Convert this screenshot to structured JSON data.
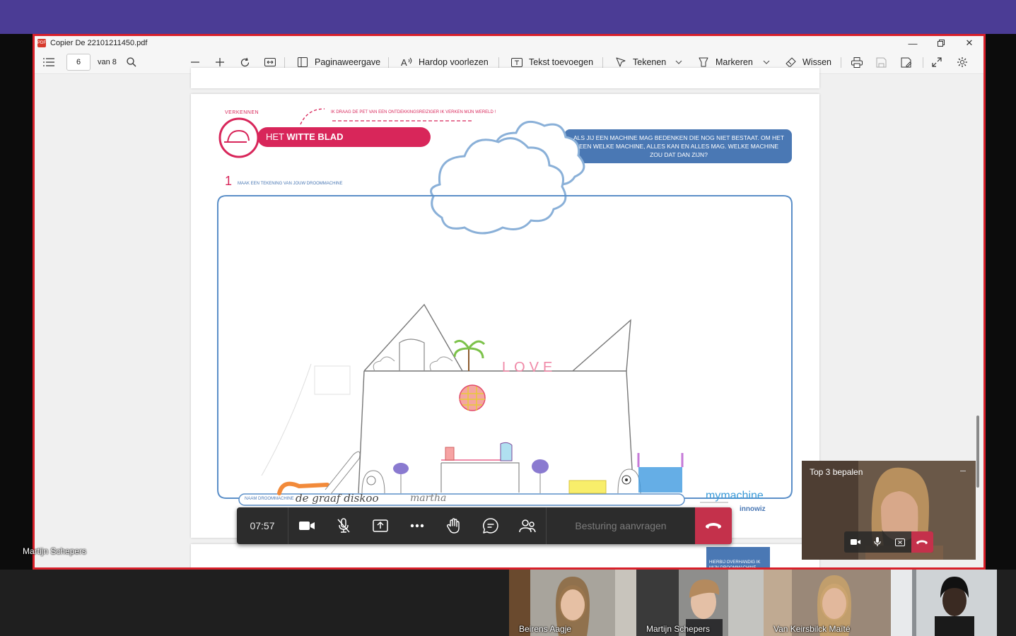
{
  "pdf_window": {
    "title": "Copier De 22101211450.pdf",
    "toolbar": {
      "page_current": "6",
      "page_total": "van 8",
      "page_view": "Paginaweergave",
      "read_aloud": "Hardop voorlezen",
      "add_text": "Tekst toevoegen",
      "draw": "Tekenen",
      "highlight": "Markeren",
      "erase": "Wissen"
    }
  },
  "worksheet": {
    "section_tag": "VERKENNEN",
    "cap_slogan": "IK DRAAG DE PET VAN EEN ONTDEKKINGSREIZIGER IK VERKEN MIJN WERELD !",
    "banner_prefix": "HET",
    "banner_title": "WITTE BLAD",
    "question": "ALS JIJ EEN MACHINE MAG BEDENKEN DIE NOG NIET BESTAAT. OM HET EEN WELKE MACHINE, ALLES KAN EN ALLES MAG. WELKE MACHINE ZOU DAT DAN ZIJN?",
    "step_number": "1",
    "step_instruction": "MAAK EEN TEKENING VAN JOUW DROOMMACHINE",
    "name_label": "NAAM DROOMMACHINE",
    "name_value": "de graaf diskoo",
    "signature": "martha",
    "drawing_word": "LOVE",
    "brand": "mymachine",
    "brand_partner": "innowiz",
    "next_page_text": "HIERBIJ OVERHANDIG IK MIJN DROOMMACHINE"
  },
  "meeting": {
    "timer": "07:57",
    "request_control": "Besturing aanvragen",
    "presenter_name": "Martijn Schepers",
    "self_view_title": "Top 3 bepalen"
  },
  "participants": [
    {
      "name": "Beirens Aagje"
    },
    {
      "name": "Martijn Schepers"
    },
    {
      "name": "Van Keirsbilck Maïté"
    }
  ],
  "colors": {
    "teams_purple": "#4b3c95",
    "share_border": "#d8202a",
    "worksheet_red": "#d8265a",
    "worksheet_blue": "#4a78b4",
    "hangup_red": "#c4314b"
  }
}
